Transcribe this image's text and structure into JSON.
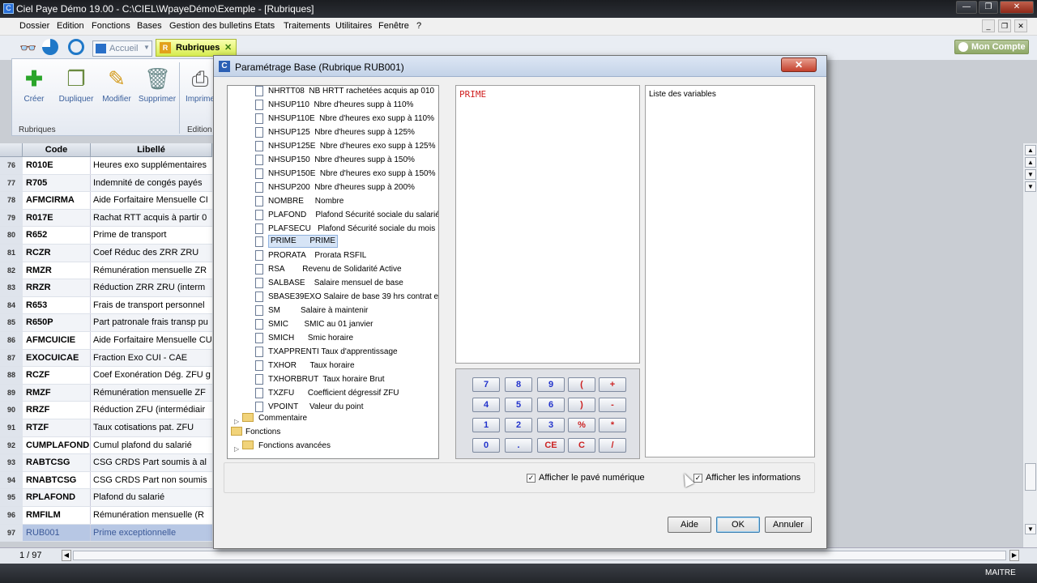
{
  "app": {
    "title": "Ciel Paye Démo 19.00 - C:\\CIEL\\WpayeDémo\\Exemple - [Rubriques]"
  },
  "menu": [
    "Dossier",
    "Edition",
    "Fonctions",
    "Bases",
    "Gestion des bulletins",
    "Etats",
    "Traitements",
    "Utilitaires",
    "Fenêtre",
    "?"
  ],
  "tabs": {
    "accueil": "Accueil",
    "rubriques": "Rubriques"
  },
  "mon_compte": "Mon Compte",
  "ribbon": {
    "buttons": [
      "Créer",
      "Dupliquer",
      "Modifier",
      "Supprimer",
      "Imprime"
    ],
    "group1": "Rubriques",
    "group2": "Edition"
  },
  "grid": {
    "headers": {
      "code": "Code",
      "libelle": "Libellé"
    },
    "rows": [
      {
        "num": "76",
        "code": "R010E",
        "lib": "Heures exo supplémentaires"
      },
      {
        "num": "77",
        "code": "R705",
        "lib": "Indemnité de congés payés"
      },
      {
        "num": "78",
        "code": "AFMCIRMA",
        "lib": "Aide Forfaitaire Mensuelle CI"
      },
      {
        "num": "79",
        "code": "R017E",
        "lib": "Rachat RTT acquis à partir 0"
      },
      {
        "num": "80",
        "code": "R652",
        "lib": "Prime de transport"
      },
      {
        "num": "81",
        "code": "RCZR",
        "lib": "Coef Réduc des ZRR ZRU"
      },
      {
        "num": "82",
        "code": "RMZR",
        "lib": "Rémunération mensuelle ZR"
      },
      {
        "num": "83",
        "code": "RRZR",
        "lib": "Réduction ZRR ZRU (interm"
      },
      {
        "num": "84",
        "code": "R653",
        "lib": "Frais de transport personnel"
      },
      {
        "num": "85",
        "code": "R650P",
        "lib": "Part patronale frais transp pu"
      },
      {
        "num": "86",
        "code": "AFMCUICIE",
        "lib": "Aide Forfaitaire Mensuelle CU"
      },
      {
        "num": "87",
        "code": "EXOCUICAE",
        "lib": "Fraction Exo CUI - CAE"
      },
      {
        "num": "88",
        "code": "RCZF",
        "lib": "Coef Exonération Dég. ZFU g"
      },
      {
        "num": "89",
        "code": "RMZF",
        "lib": "Rémunération mensuelle ZF"
      },
      {
        "num": "90",
        "code": "RRZF",
        "lib": "Réduction ZFU (intermédiair"
      },
      {
        "num": "91",
        "code": "RTZF",
        "lib": "Taux cotisations pat. ZFU"
      },
      {
        "num": "92",
        "code": "CUMPLAFOND",
        "lib": "Cumul plafond du salarié"
      },
      {
        "num": "93",
        "code": "RABTCSG",
        "lib": "CSG CRDS Part soumis à al"
      },
      {
        "num": "94",
        "code": "RNABTCSG",
        "lib": "CSG CRDS Part non soumis"
      },
      {
        "num": "95",
        "code": "RPLAFOND",
        "lib": "Plafond du salarié"
      },
      {
        "num": "96",
        "code": "RMFILM",
        "lib": "Rémunération mensuelle (R"
      },
      {
        "num": "97",
        "code": "RUB001",
        "lib": "Prime exceptionnelle"
      }
    ],
    "footer": "1 / 97"
  },
  "status": {
    "user": "MAITRE"
  },
  "dialog": {
    "title": "Paramétrage Base (Rubrique RUB001)",
    "tree": [
      "NHRTT08  NB HRTT rachetées acquis ap 010",
      "NHSUP110  Nbre d'heures supp à 110%",
      "NHSUP110E  Nbre d'heures exo supp à 110%",
      "NHSUP125  Nbre d'heures supp à 125%",
      "NHSUP125E  Nbre d'heures exo supp à 125%",
      "NHSUP150  Nbre d'heures supp à 150%",
      "NHSUP150E  Nbre d'heures exo supp à 150%",
      "NHSUP200  Nbre d'heures supp à 200%",
      "NOMBRE     Nombre",
      "PLAFOND    Plafond Sécurité sociale du salarié",
      "PLAFSECU   Plafond Sécurité sociale du mois",
      "PRIME      PRIME",
      "PRORATA    Prorata RSFIL",
      "RSA        Revenu de Solidarité Active",
      "SALBASE    Salaire mensuel de base",
      "SBASE39EXO Salaire de base 39 hrs contrat e",
      "SM         Salaire à maintenir",
      "SMIC       SMIC au 01 janvier",
      "SMICH      Smic horaire",
      "TXAPPRENTI Taux d'apprentissage",
      "TXHOR      Taux horaire",
      "TXHORBRUT  Taux horaire Brut",
      "TXZFU      Coefficient dégressif ZFU",
      "VPOINT     Valeur du point"
    ],
    "folders": {
      "commentaire": "Commentaire",
      "fonctions": "Fonctions",
      "fonctions_avancees": "Fonctions avancées"
    },
    "formula": "PRIME",
    "variables_title": "Liste des variables",
    "keypad": [
      [
        "7",
        "8",
        "9",
        "(",
        "+"
      ],
      [
        "4",
        "5",
        "6",
        ")",
        "-"
      ],
      [
        "1",
        "2",
        "3",
        "%",
        "*"
      ],
      [
        "0",
        ".",
        "CE",
        "C",
        "/"
      ]
    ],
    "checkboxes": {
      "pave": "Afficher le pavé numérique",
      "infos": "Afficher les informations"
    },
    "buttons": {
      "aide": "Aide",
      "ok": "OK",
      "annuler": "Annuler"
    }
  }
}
